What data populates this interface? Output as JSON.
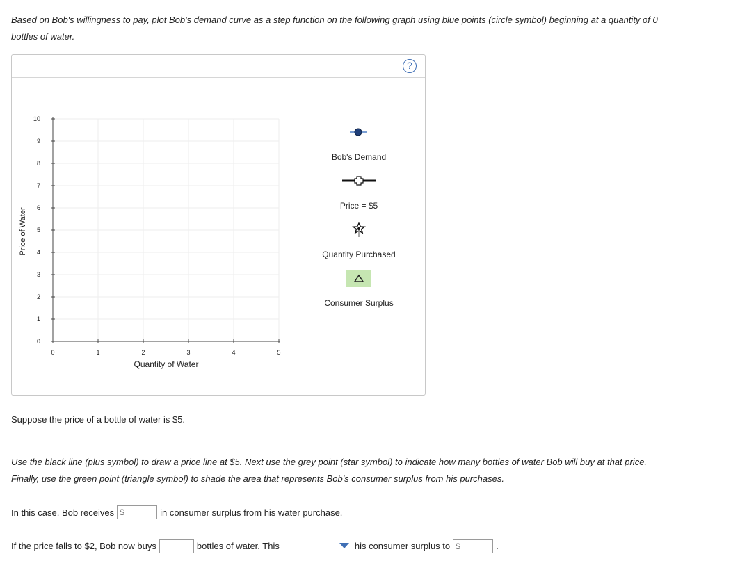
{
  "intro": "Based on Bob's willingness to pay, plot Bob's demand curve as a step function on the following graph using blue points (circle symbol) beginning at a quantity of 0 bottles of water.",
  "help": "?",
  "graph": {
    "ylabel": "Price of Water",
    "xlabel": "Quantity of Water",
    "yticks": [
      "0",
      "1",
      "2",
      "3",
      "4",
      "5",
      "6",
      "7",
      "8",
      "9",
      "10"
    ],
    "xticks": [
      "0",
      "1",
      "2",
      "3",
      "4",
      "5"
    ],
    "ylim": [
      0,
      10
    ],
    "xlim": [
      0,
      5
    ],
    "grid": true
  },
  "tools": [
    {
      "label": "Bob's Demand",
      "icon": "blue-circle-line-icon"
    },
    {
      "label": "Price = $5",
      "icon": "black-plus-line-icon"
    },
    {
      "label": "Quantity Purchased",
      "icon": "grey-star-icon"
    },
    {
      "label": "Consumer Surplus",
      "icon": "green-triangle-icon"
    }
  ],
  "prompt1": "Suppose the price of a bottle of water is $5.",
  "instructions": "Use the black line (plus symbol) to draw a price line at $5. Next use the grey point (star symbol) to indicate how many bottles of water Bob will buy at that price. Finally, use the green point (triangle symbol) to shade the area that represents Bob's consumer surplus from his purchases.",
  "row1": {
    "before": "In this case, Bob receives",
    "placeholder": "$",
    "after": "in consumer surplus from his water purchase."
  },
  "row2": {
    "before": "If the price falls to $2, Bob now buys",
    "middle": "bottles of water. This",
    "after": "his consumer surplus to",
    "placeholder": "$",
    "end": "."
  },
  "colors": {
    "demand": "#1f3f7a",
    "demand_line": "#7a9fd4",
    "price": "#111111",
    "star": "#9a9a9a",
    "surplus_fill": "#c6e6b2",
    "link": "#3f6fb5"
  }
}
